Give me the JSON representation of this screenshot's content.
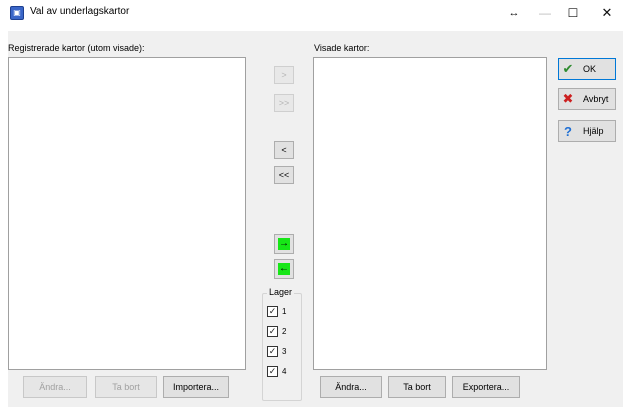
{
  "window": {
    "title": "Val av underlagskartor",
    "app_icon_text": "▣",
    "resize_glyph": "↔",
    "minimize_glyph": "—",
    "maximize_glyph": "☐",
    "close_glyph": "✕"
  },
  "left": {
    "label": "Registrerade kartor (utom visade):",
    "buttons": {
      "edit": "Ändra...",
      "remove": "Ta bort",
      "import": "Importera..."
    }
  },
  "middle": {
    "move_one_right": ">",
    "move_all_right": ">>",
    "move_one_left": "<",
    "move_all_left": "<<",
    "green_right": "→",
    "green_left": "←",
    "layers_legend": "Lager",
    "layers": [
      {
        "label": "1",
        "checked": true
      },
      {
        "label": "2",
        "checked": true
      },
      {
        "label": "3",
        "checked": true
      },
      {
        "label": "4",
        "checked": true
      }
    ],
    "check_glyph": "✓"
  },
  "right": {
    "label": "Visade kartor:",
    "buttons": {
      "edit": "Ändra...",
      "remove": "Ta bort",
      "export": "Exportera..."
    }
  },
  "side": {
    "ok": {
      "label": "OK",
      "icon": "✔"
    },
    "cancel": {
      "label": "Avbryt",
      "icon": "✖"
    },
    "help": {
      "label": "Hjälp",
      "icon": "?"
    }
  },
  "colors": {
    "accent_green": "#17e617",
    "ok_icon": "#2e8b2e",
    "cancel_icon": "#cc1f1f",
    "help_icon": "#1f6fd4"
  }
}
